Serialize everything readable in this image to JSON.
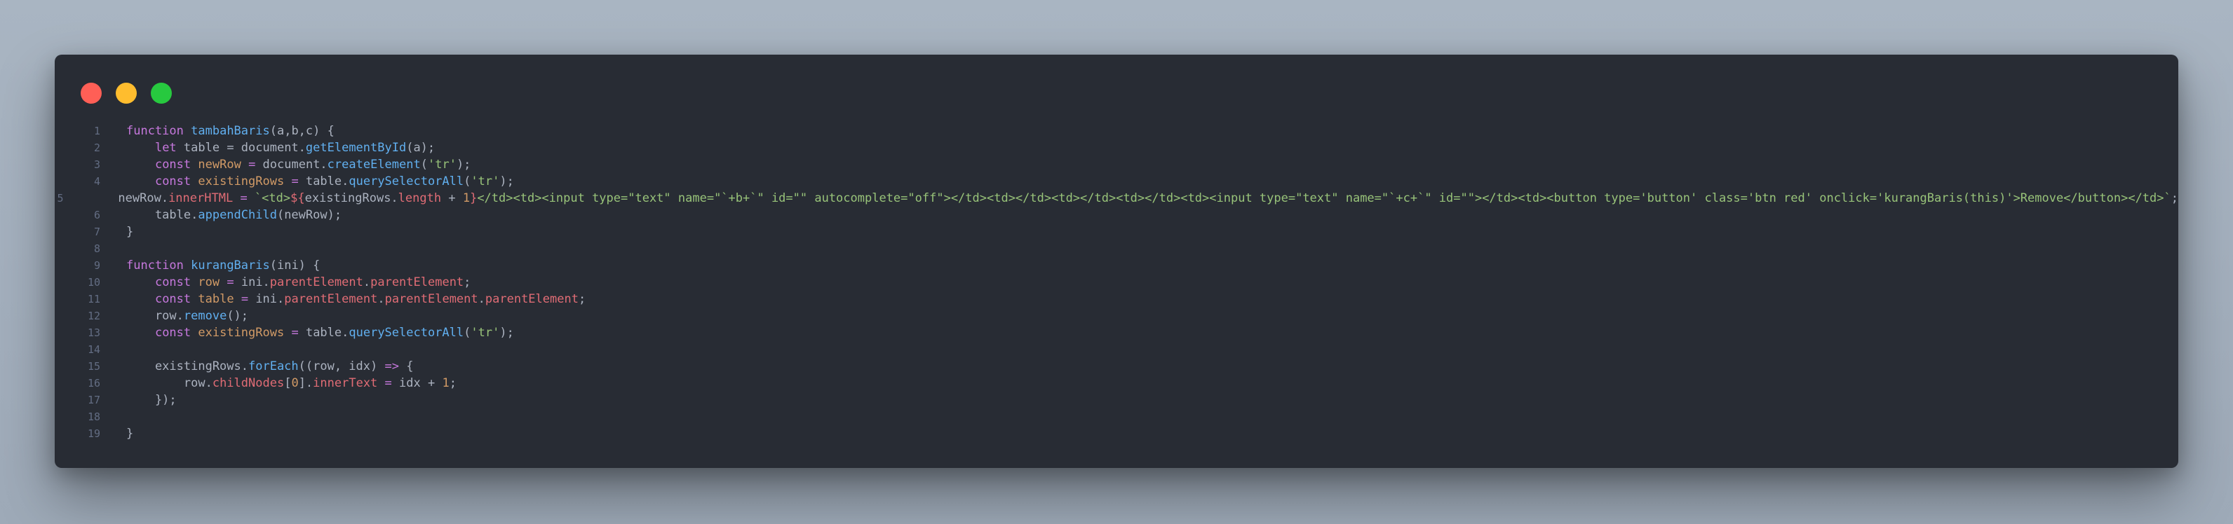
{
  "window": {
    "traffic_lights": [
      {
        "name": "close-icon",
        "color": "#ff5f56"
      },
      {
        "name": "minimize-icon",
        "color": "#ffbd2e"
      },
      {
        "name": "maximize-icon",
        "color": "#27c93f"
      }
    ]
  },
  "theme": {
    "background": "#282c34",
    "keyword": "#c678dd",
    "function": "#61afef",
    "property": "#e06c75",
    "string": "#98c379",
    "number": "#d19a66",
    "plain": "#abb2bf",
    "line_number": "#636d83"
  },
  "code": {
    "lines": [
      {
        "num": "1",
        "tokens": [
          [
            "function",
            "keyword"
          ],
          [
            " ",
            "plain"
          ],
          [
            "tambahBaris",
            "function"
          ],
          [
            "(a,b,c) {",
            "plain"
          ]
        ]
      },
      {
        "num": "2",
        "tokens": [
          [
            "    ",
            "plain"
          ],
          [
            "let",
            "keyword"
          ],
          [
            " table = document.",
            "plain"
          ],
          [
            "getElementById",
            "function"
          ],
          [
            "(a);",
            "plain"
          ]
        ]
      },
      {
        "num": "3",
        "tokens": [
          [
            "    ",
            "plain"
          ],
          [
            "const",
            "keyword"
          ],
          [
            " ",
            "plain"
          ],
          [
            "newRow",
            "number"
          ],
          [
            " ",
            "plain"
          ],
          [
            "=",
            "keyword"
          ],
          [
            " document.",
            "plain"
          ],
          [
            "createElement",
            "function"
          ],
          [
            "(",
            "plain"
          ],
          [
            "'tr'",
            "string"
          ],
          [
            ");",
            "plain"
          ]
        ]
      },
      {
        "num": "4",
        "tokens": [
          [
            "    ",
            "plain"
          ],
          [
            "const",
            "keyword"
          ],
          [
            " ",
            "plain"
          ],
          [
            "existingRows",
            "number"
          ],
          [
            " ",
            "plain"
          ],
          [
            "=",
            "keyword"
          ],
          [
            " table.",
            "plain"
          ],
          [
            "querySelectorAll",
            "function"
          ],
          [
            "(",
            "plain"
          ],
          [
            "'tr'",
            "string"
          ],
          [
            ");",
            "plain"
          ]
        ]
      },
      {
        "num": "5",
        "tokens": [
          [
            "    newRow.",
            "plain"
          ],
          [
            "innerHTML",
            "property"
          ],
          [
            " ",
            "plain"
          ],
          [
            "=",
            "keyword"
          ],
          [
            " ",
            "plain"
          ],
          [
            "`<td>",
            "string"
          ],
          [
            "${",
            "property"
          ],
          [
            "existingRows.",
            "plain"
          ],
          [
            "length",
            "property"
          ],
          [
            " + ",
            "plain"
          ],
          [
            "1",
            "number"
          ],
          [
            "}",
            "property"
          ],
          [
            "</td><td><input type=\"text\" name=\"`+b+`\" id=\"\" autocomplete=\"off\"></td><td></td><td></td><td></td><td><input type=\"text\" name=\"`+c+`\" id=\"\"></td><td><button type='button' class='btn red' onclick='kurangBaris(this)'>Remove</button></td>`",
            "string"
          ],
          [
            ";",
            "plain"
          ]
        ]
      },
      {
        "num": "6",
        "tokens": [
          [
            "    table.",
            "plain"
          ],
          [
            "appendChild",
            "function"
          ],
          [
            "(newRow);",
            "plain"
          ]
        ]
      },
      {
        "num": "7",
        "tokens": [
          [
            "}",
            "plain"
          ]
        ]
      },
      {
        "num": "8",
        "tokens": []
      },
      {
        "num": "9",
        "tokens": [
          [
            "function",
            "keyword"
          ],
          [
            " ",
            "plain"
          ],
          [
            "kurangBaris",
            "function"
          ],
          [
            "(ini) {",
            "plain"
          ]
        ]
      },
      {
        "num": "10",
        "tokens": [
          [
            "    ",
            "plain"
          ],
          [
            "const",
            "keyword"
          ],
          [
            " ",
            "plain"
          ],
          [
            "row",
            "number"
          ],
          [
            " ",
            "plain"
          ],
          [
            "=",
            "keyword"
          ],
          [
            " ini.",
            "plain"
          ],
          [
            "parentElement",
            "property"
          ],
          [
            ".",
            "plain"
          ],
          [
            "parentElement",
            "property"
          ],
          [
            ";",
            "plain"
          ]
        ]
      },
      {
        "num": "11",
        "tokens": [
          [
            "    ",
            "plain"
          ],
          [
            "const",
            "keyword"
          ],
          [
            " ",
            "plain"
          ],
          [
            "table",
            "number"
          ],
          [
            " ",
            "plain"
          ],
          [
            "=",
            "keyword"
          ],
          [
            " ini.",
            "plain"
          ],
          [
            "parentElement",
            "property"
          ],
          [
            ".",
            "plain"
          ],
          [
            "parentElement",
            "property"
          ],
          [
            ".",
            "plain"
          ],
          [
            "parentElement",
            "property"
          ],
          [
            ";",
            "plain"
          ]
        ]
      },
      {
        "num": "12",
        "tokens": [
          [
            "    row.",
            "plain"
          ],
          [
            "remove",
            "function"
          ],
          [
            "();",
            "plain"
          ]
        ]
      },
      {
        "num": "13",
        "tokens": [
          [
            "    ",
            "plain"
          ],
          [
            "const",
            "keyword"
          ],
          [
            " ",
            "plain"
          ],
          [
            "existingRows",
            "number"
          ],
          [
            " ",
            "plain"
          ],
          [
            "=",
            "keyword"
          ],
          [
            " table.",
            "plain"
          ],
          [
            "querySelectorAll",
            "function"
          ],
          [
            "(",
            "plain"
          ],
          [
            "'tr'",
            "string"
          ],
          [
            ");",
            "plain"
          ]
        ]
      },
      {
        "num": "14",
        "tokens": []
      },
      {
        "num": "15",
        "tokens": [
          [
            "    existingRows.",
            "plain"
          ],
          [
            "forEach",
            "function"
          ],
          [
            "((row, idx) ",
            "plain"
          ],
          [
            "=>",
            "keyword"
          ],
          [
            " {",
            "plain"
          ]
        ]
      },
      {
        "num": "16",
        "tokens": [
          [
            "        row.",
            "plain"
          ],
          [
            "childNodes",
            "property"
          ],
          [
            "[",
            "plain"
          ],
          [
            "0",
            "number"
          ],
          [
            "].",
            "plain"
          ],
          [
            "innerText",
            "property"
          ],
          [
            " ",
            "plain"
          ],
          [
            "=",
            "keyword"
          ],
          [
            " idx + ",
            "plain"
          ],
          [
            "1",
            "number"
          ],
          [
            ";",
            "plain"
          ]
        ]
      },
      {
        "num": "17",
        "tokens": [
          [
            "    });",
            "plain"
          ]
        ]
      },
      {
        "num": "18",
        "tokens": []
      },
      {
        "num": "19",
        "tokens": [
          [
            "}",
            "plain"
          ]
        ]
      }
    ]
  }
}
